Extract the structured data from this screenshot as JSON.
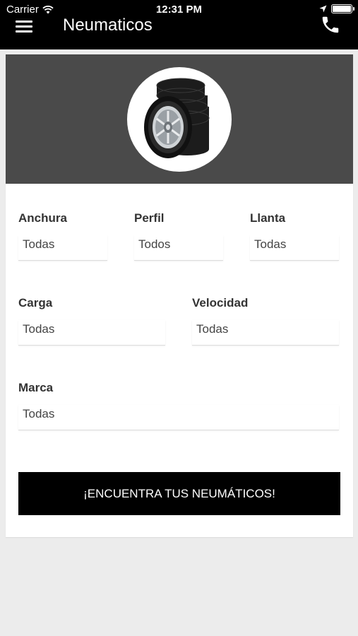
{
  "status_bar": {
    "carrier": "Carrier",
    "time": "12:31 PM",
    "wifi_icon": "wifi-icon",
    "location_icon": "location-arrow-icon",
    "battery_icon": "battery-full-icon",
    "battery_level": 1.0
  },
  "header": {
    "menu_icon": "hamburger-menu-icon",
    "title": "Neumaticos",
    "phone_icon": "phone-icon"
  },
  "hero": {
    "image": "stacked-tires-image"
  },
  "filters": {
    "anchura": {
      "label": "Anchura",
      "value": "Todas"
    },
    "perfil": {
      "label": "Perfil",
      "value": "Todos"
    },
    "llanta": {
      "label": "Llanta",
      "value": "Todas"
    },
    "carga": {
      "label": "Carga",
      "value": "Todas"
    },
    "velocidad": {
      "label": "Velocidad",
      "value": "Todas"
    },
    "marca": {
      "label": "Marca",
      "value": "Todas"
    }
  },
  "cta": {
    "label": "¡ENCUENTRA TUS NEUMÁTICOS!"
  },
  "colors": {
    "header_bg": "#000000",
    "hero_bg": "#4a4a4a",
    "page_bg": "#ececec",
    "button_bg": "#000000",
    "label_text": "#333333"
  }
}
